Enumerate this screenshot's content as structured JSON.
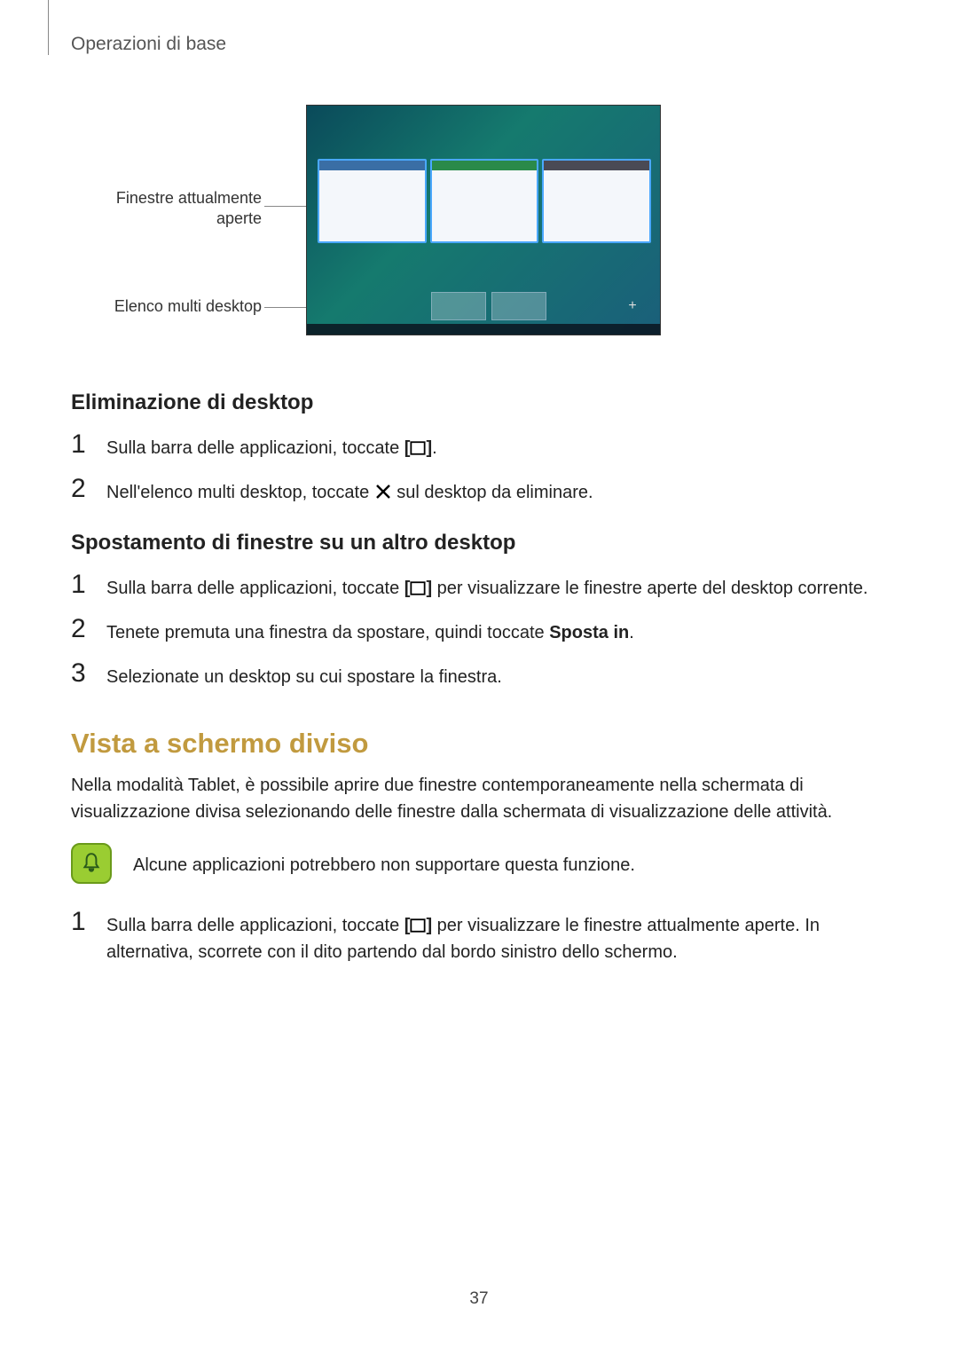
{
  "header": "Operazioni di base",
  "figure": {
    "label_open_windows_line1": "Finestre attualmente",
    "label_open_windows_line2": "aperte",
    "label_multi_desktop": "Elenco multi desktop"
  },
  "section_delete": {
    "title": "Eliminazione di desktop",
    "step1_pre": "Sulla barra delle applicazioni, toccate ",
    "step1_post": ".",
    "step2_pre": "Nell'elenco multi desktop, toccate ",
    "step2_post": " sul desktop da eliminare."
  },
  "section_move": {
    "title": "Spostamento di finestre su un altro desktop",
    "step1_pre": "Sulla barra delle applicazioni, toccate ",
    "step1_post": " per visualizzare le finestre aperte del desktop corrente.",
    "step2_pre": "Tenete premuta una finestra da spostare, quindi toccate ",
    "step2_bold": "Sposta in",
    "step2_post": ".",
    "step3": "Selezionate un desktop su cui spostare la finestra."
  },
  "section_split": {
    "title": "Vista a schermo diviso",
    "intro": "Nella modalità Tablet, è possibile aprire due finestre contemporaneamente nella schermata di visualizzazione divisa selezionando delle finestre dalla schermata di visualizzazione delle attività.",
    "note": "Alcune applicazioni potrebbero non supportare questa funzione.",
    "step1_pre": "Sulla barra delle applicazioni, toccate ",
    "step1_post": " per visualizzare le finestre attualmente aperte. In alternativa, scorrete con il dito partendo dal bordo sinistro dello schermo."
  },
  "icons": {
    "task_view": "task-view-icon",
    "close_x": "close-x-icon",
    "bell": "bell-icon"
  },
  "page_number": "37"
}
